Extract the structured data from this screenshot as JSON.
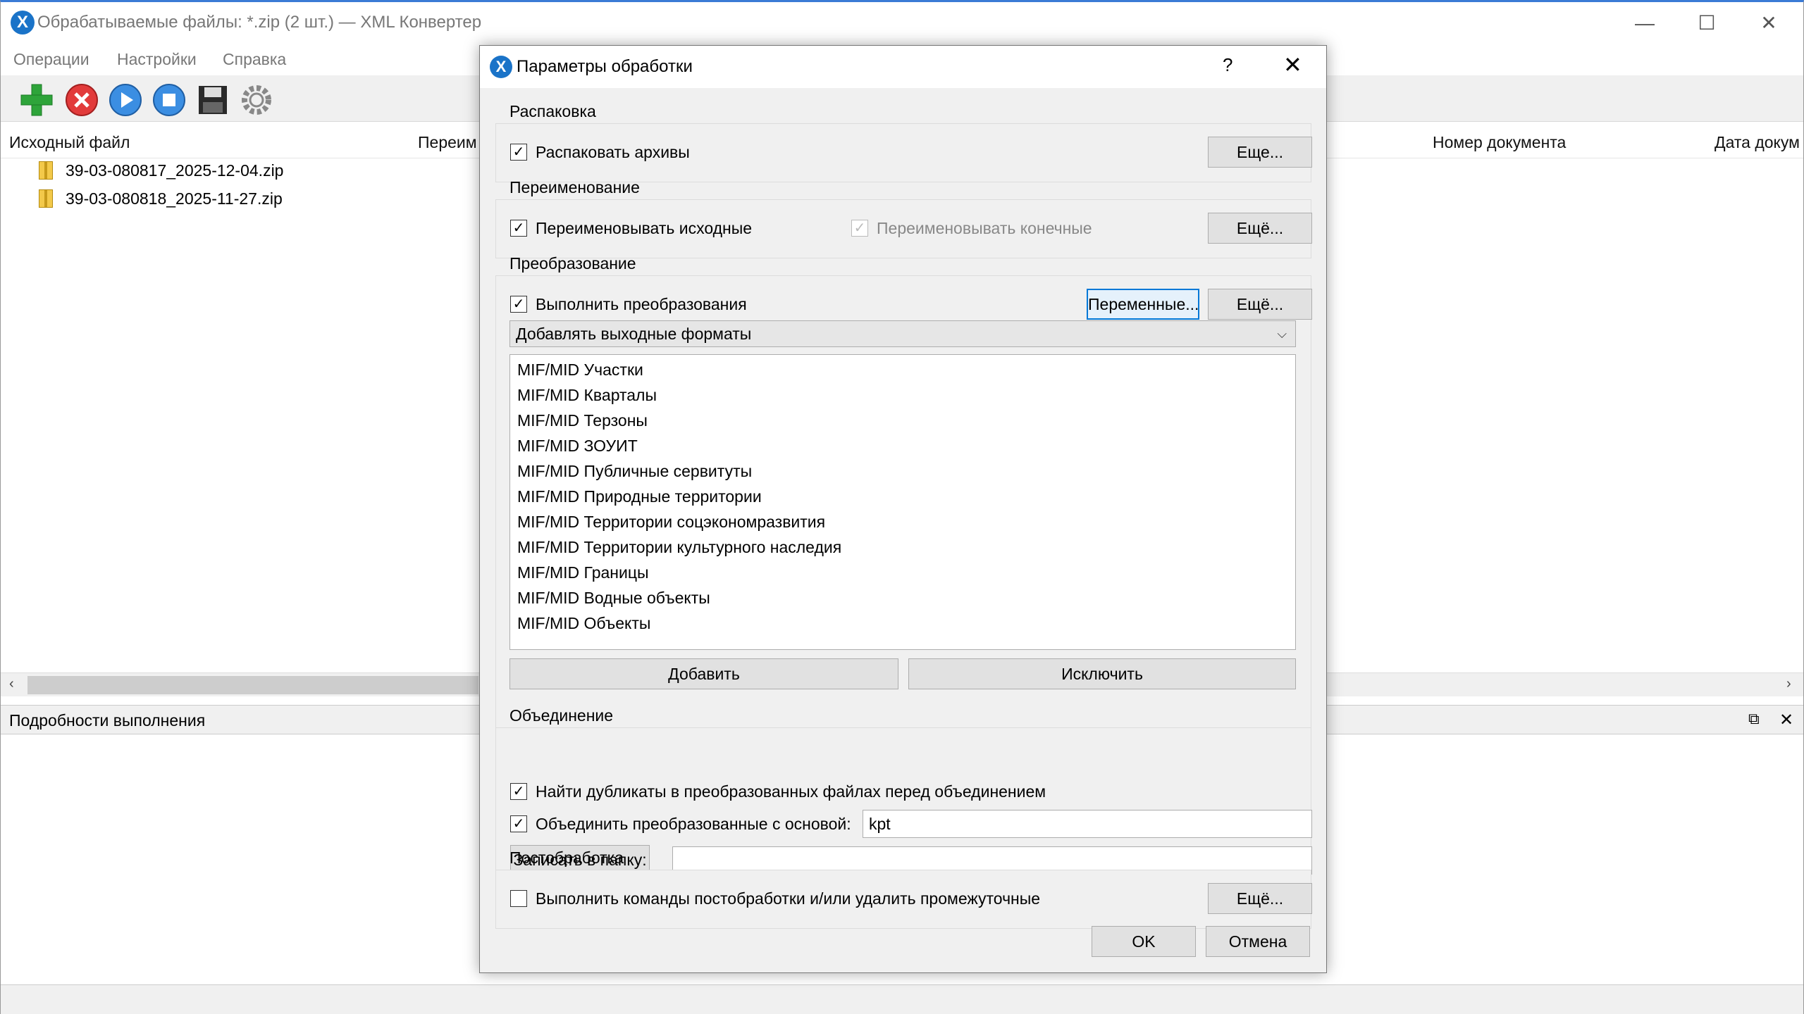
{
  "window": {
    "title": "Обрабатываемые файлы: *.zip (2 шт.) — XML Конвертер",
    "icon_letter": "X",
    "minimize": "—",
    "maximize": "☐",
    "close": "✕"
  },
  "menu": {
    "operations": "Операции",
    "settings": "Настройки",
    "help": "Справка"
  },
  "file_list": {
    "columns": [
      "Исходный файл",
      "Переим",
      "Номер документа",
      "Дата докум"
    ],
    "rows": [
      {
        "name": "39-03-080817_2025-12-04.zip"
      },
      {
        "name": "39-03-080818_2025-11-27.zip"
      }
    ]
  },
  "scroll": {
    "left": "‹",
    "right": "›"
  },
  "details": {
    "title": "Подробности выполнения",
    "restore": "⧉",
    "close": "✕"
  },
  "dialog": {
    "title": "Параметры обработки",
    "help": "?",
    "close": "✕",
    "unpack": {
      "title": "Распаковка",
      "checkbox_label": "Распаковать архивы",
      "checked": true,
      "more_button": "Еще..."
    },
    "rename": {
      "title": "Переименование",
      "source_label": "Переименовывать исходные",
      "source_checked": true,
      "target_label": "Переименовывать конечные",
      "target_checked": true,
      "more_button": "Ещё..."
    },
    "transform": {
      "title": "Преобразование",
      "checkbox_label": "Выполнить преобразования",
      "checked": true,
      "variables_button": "Переменные...",
      "more_button": "Ещё...",
      "select_value": "Добавлять выходные форматы",
      "formats": [
        "MIF/MID Участки",
        "MIF/MID Кварталы",
        "MIF/MID Терзоны",
        "MIF/MID ЗОУИТ",
        "MIF/MID Публичные сервитуты",
        "MIF/MID Природные территории",
        "MIF/MID Территории соцэкономразвития",
        "MIF/MID Территории культурного наследия",
        "MIF/MID Границы",
        "MIF/MID Водные объекты",
        "MIF/MID Объекты"
      ],
      "add_button": "Добавить",
      "exclude_button": "Исключить"
    },
    "merge": {
      "title": "Объединение",
      "duplicates_label": "Найти дубликаты в преобразованных файлах перед объединением",
      "duplicates_checked": true,
      "merge_label": "Объединить преобразованные с основой:",
      "merge_checked": true,
      "merge_value": "kpt",
      "folder_button": "Записать в папку:",
      "folder_value": ""
    },
    "post": {
      "title": "Постобработка",
      "checkbox_label": "Выполнить команды постобработки и/или удалить промежуточные",
      "checked": false,
      "more_button": "Ещё..."
    },
    "ok_button": "OK",
    "cancel_button": "Отмена"
  }
}
